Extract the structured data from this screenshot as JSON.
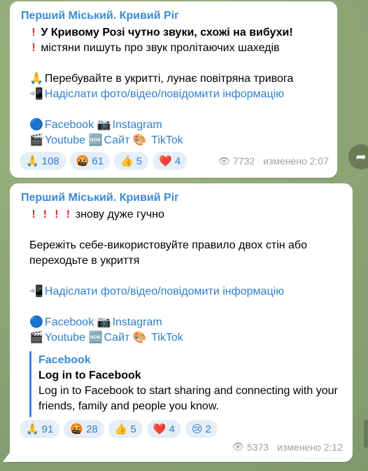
{
  "messages": [
    {
      "author": "Перший Міський. Кривий Ріг",
      "line1": "У Кривому Розі чутно звуки, схожі на вибухи!",
      "line2": "містяни пишуть про звук пролітаючих шахедів",
      "line3": "Перебувайте в укритті, лунає повітряна тривога",
      "submit_link": "Надіслати фото/відео/повідомити інформацію",
      "social": {
        "facebook": "Facebook",
        "instagram": "Instagram",
        "youtube": "Youtube",
        "site": "Сайт",
        "tiktok": "TikTok"
      },
      "reactions": [
        {
          "emoji": "🙏",
          "count": "108"
        },
        {
          "emoji": "🤬",
          "count": "61"
        },
        {
          "emoji": "👍",
          "count": "5"
        },
        {
          "emoji": "❤️",
          "count": "4"
        }
      ],
      "views": "7732",
      "edited": "изменено 2:07"
    },
    {
      "author": "Перший Міський. Кривий Ріг",
      "line1": "знову дуже гучно",
      "line2": "Бережіть себе-використовуйте правило двох стін або",
      "line3": "переходьте в укриття",
      "submit_link": "Надіслати фото/відео/повідомити інформацію",
      "social": {
        "facebook": "Facebook",
        "instagram": "Instagram",
        "youtube": "Youtube",
        "site": "Сайт",
        "tiktok": "TikTok"
      },
      "preview": {
        "site": "Facebook",
        "title": "Log in to Facebook",
        "description": "Log in to Facebook to start sharing and connecting with your friends, family and people you know."
      },
      "reactions": [
        {
          "emoji": "🙏",
          "count": "91"
        },
        {
          "emoji": "🤬",
          "count": "28"
        },
        {
          "emoji": "👍",
          "count": "5"
        },
        {
          "emoji": "❤️",
          "count": "4"
        },
        {
          "emoji": "😢",
          "count": "2"
        }
      ],
      "views": "5373",
      "edited": "изменено 2:12"
    }
  ]
}
